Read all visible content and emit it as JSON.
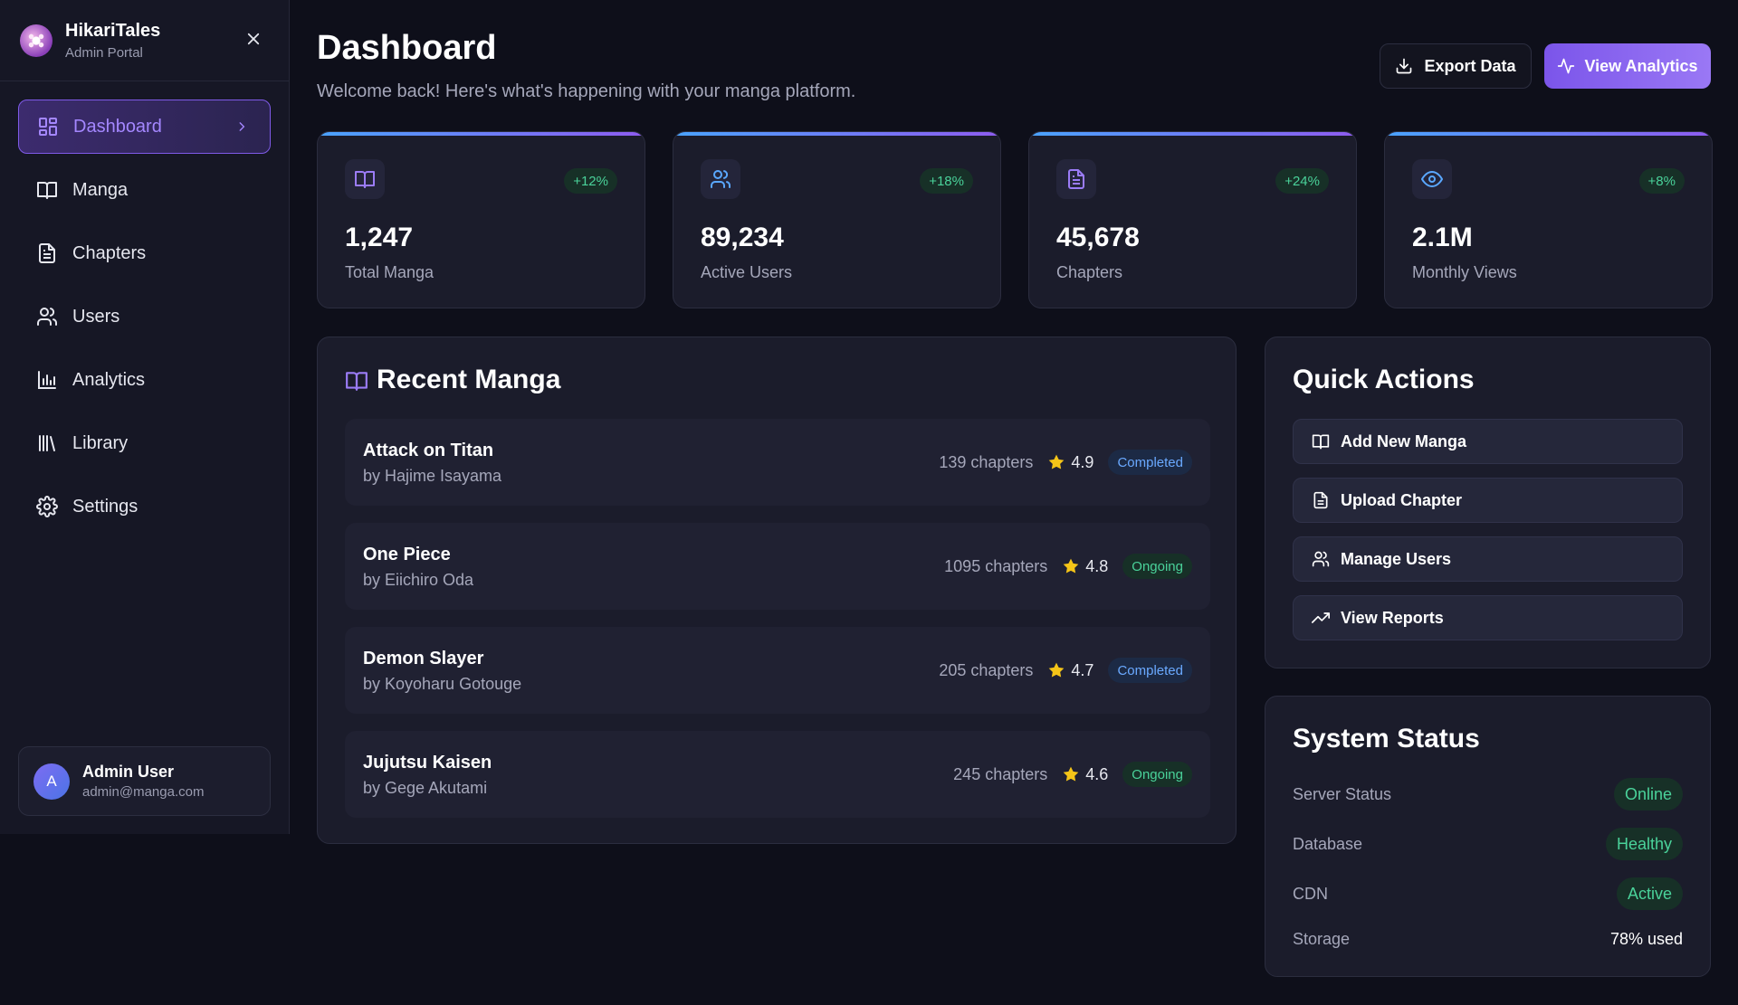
{
  "brand": {
    "name": "HikariTales",
    "subtitle": "Admin Portal"
  },
  "nav": [
    {
      "label": "Dashboard",
      "icon": "dashboard-icon",
      "active": true
    },
    {
      "label": "Manga",
      "icon": "book-icon"
    },
    {
      "label": "Chapters",
      "icon": "document-icon"
    },
    {
      "label": "Users",
      "icon": "users-icon"
    },
    {
      "label": "Analytics",
      "icon": "bar-chart-icon"
    },
    {
      "label": "Library",
      "icon": "library-icon"
    },
    {
      "label": "Settings",
      "icon": "gear-icon"
    }
  ],
  "user": {
    "initial": "A",
    "name": "Admin User",
    "email": "admin@manga.com"
  },
  "header": {
    "title": "Dashboard",
    "subtitle": "Welcome back! Here's what's happening with your manga platform.",
    "export_label": "Export Data",
    "analytics_label": "View Analytics"
  },
  "stats": [
    {
      "value": "1,247",
      "label": "Total Manga",
      "change": "+12%",
      "icon": "book-icon"
    },
    {
      "value": "89,234",
      "label": "Active Users",
      "change": "+18%",
      "icon": "users-icon"
    },
    {
      "value": "45,678",
      "label": "Chapters",
      "change": "+24%",
      "icon": "document-icon"
    },
    {
      "value": "2.1M",
      "label": "Monthly Views",
      "change": "+8%",
      "icon": "eye-icon"
    }
  ],
  "recent": {
    "title": "Recent Manga",
    "items": [
      {
        "title": "Attack on Titan",
        "author": "by Hajime Isayama",
        "chapters": "139 chapters",
        "rating": "4.9",
        "status": "Completed"
      },
      {
        "title": "One Piece",
        "author": "by Eiichiro Oda",
        "chapters": "1095 chapters",
        "rating": "4.8",
        "status": "Ongoing"
      },
      {
        "title": "Demon Slayer",
        "author": "by Koyoharu Gotouge",
        "chapters": "205 chapters",
        "rating": "4.7",
        "status": "Completed"
      },
      {
        "title": "Jujutsu Kaisen",
        "author": "by Gege Akutami",
        "chapters": "245 chapters",
        "rating": "4.6",
        "status": "Ongoing"
      }
    ]
  },
  "quick_actions": {
    "title": "Quick Actions",
    "items": [
      {
        "label": "Add New Manga",
        "icon": "book-icon"
      },
      {
        "label": "Upload Chapter",
        "icon": "document-icon"
      },
      {
        "label": "Manage Users",
        "icon": "users-icon"
      },
      {
        "label": "View Reports",
        "icon": "trending-up-icon"
      }
    ]
  },
  "system": {
    "title": "System Status",
    "rows": [
      {
        "label": "Server Status",
        "value": "Online"
      },
      {
        "label": "Database",
        "value": "Healthy"
      },
      {
        "label": "CDN",
        "value": "Active"
      },
      {
        "label": "Storage",
        "value": "78% used"
      }
    ]
  },
  "colors": {
    "accent": "#8b5cf6",
    "success": "#4ad29a",
    "info": "#6aa9ff",
    "background": "#0e0f1a"
  }
}
